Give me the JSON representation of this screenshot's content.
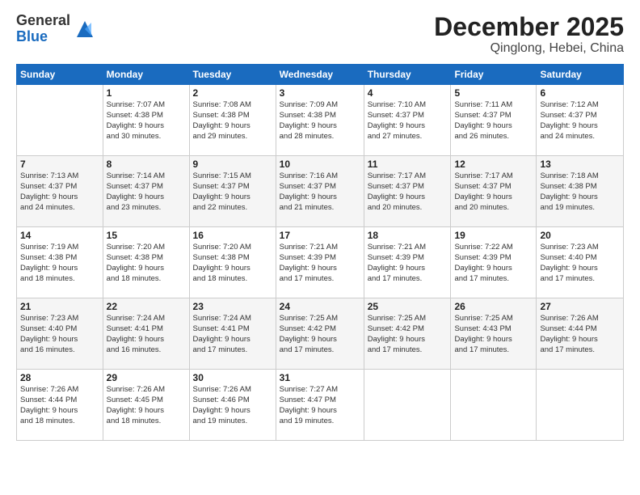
{
  "logo": {
    "general": "General",
    "blue": "Blue"
  },
  "title": "December 2025",
  "subtitle": "Qinglong, Hebei, China",
  "days_of_week": [
    "Sunday",
    "Monday",
    "Tuesday",
    "Wednesday",
    "Thursday",
    "Friday",
    "Saturday"
  ],
  "weeks": [
    [
      {
        "day": "",
        "info": ""
      },
      {
        "day": "1",
        "info": "Sunrise: 7:07 AM\nSunset: 4:38 PM\nDaylight: 9 hours\nand 30 minutes."
      },
      {
        "day": "2",
        "info": "Sunrise: 7:08 AM\nSunset: 4:38 PM\nDaylight: 9 hours\nand 29 minutes."
      },
      {
        "day": "3",
        "info": "Sunrise: 7:09 AM\nSunset: 4:38 PM\nDaylight: 9 hours\nand 28 minutes."
      },
      {
        "day": "4",
        "info": "Sunrise: 7:10 AM\nSunset: 4:37 PM\nDaylight: 9 hours\nand 27 minutes."
      },
      {
        "day": "5",
        "info": "Sunrise: 7:11 AM\nSunset: 4:37 PM\nDaylight: 9 hours\nand 26 minutes."
      },
      {
        "day": "6",
        "info": "Sunrise: 7:12 AM\nSunset: 4:37 PM\nDaylight: 9 hours\nand 24 minutes."
      }
    ],
    [
      {
        "day": "7",
        "info": "Sunrise: 7:13 AM\nSunset: 4:37 PM\nDaylight: 9 hours\nand 24 minutes."
      },
      {
        "day": "8",
        "info": "Sunrise: 7:14 AM\nSunset: 4:37 PM\nDaylight: 9 hours\nand 23 minutes."
      },
      {
        "day": "9",
        "info": "Sunrise: 7:15 AM\nSunset: 4:37 PM\nDaylight: 9 hours\nand 22 minutes."
      },
      {
        "day": "10",
        "info": "Sunrise: 7:16 AM\nSunset: 4:37 PM\nDaylight: 9 hours\nand 21 minutes."
      },
      {
        "day": "11",
        "info": "Sunrise: 7:17 AM\nSunset: 4:37 PM\nDaylight: 9 hours\nand 20 minutes."
      },
      {
        "day": "12",
        "info": "Sunrise: 7:17 AM\nSunset: 4:37 PM\nDaylight: 9 hours\nand 20 minutes."
      },
      {
        "day": "13",
        "info": "Sunrise: 7:18 AM\nSunset: 4:38 PM\nDaylight: 9 hours\nand 19 minutes."
      }
    ],
    [
      {
        "day": "14",
        "info": "Sunrise: 7:19 AM\nSunset: 4:38 PM\nDaylight: 9 hours\nand 18 minutes."
      },
      {
        "day": "15",
        "info": "Sunrise: 7:20 AM\nSunset: 4:38 PM\nDaylight: 9 hours\nand 18 minutes."
      },
      {
        "day": "16",
        "info": "Sunrise: 7:20 AM\nSunset: 4:38 PM\nDaylight: 9 hours\nand 18 minutes."
      },
      {
        "day": "17",
        "info": "Sunrise: 7:21 AM\nSunset: 4:39 PM\nDaylight: 9 hours\nand 17 minutes."
      },
      {
        "day": "18",
        "info": "Sunrise: 7:21 AM\nSunset: 4:39 PM\nDaylight: 9 hours\nand 17 minutes."
      },
      {
        "day": "19",
        "info": "Sunrise: 7:22 AM\nSunset: 4:39 PM\nDaylight: 9 hours\nand 17 minutes."
      },
      {
        "day": "20",
        "info": "Sunrise: 7:23 AM\nSunset: 4:40 PM\nDaylight: 9 hours\nand 17 minutes."
      }
    ],
    [
      {
        "day": "21",
        "info": "Sunrise: 7:23 AM\nSunset: 4:40 PM\nDaylight: 9 hours\nand 16 minutes."
      },
      {
        "day": "22",
        "info": "Sunrise: 7:24 AM\nSunset: 4:41 PM\nDaylight: 9 hours\nand 16 minutes."
      },
      {
        "day": "23",
        "info": "Sunrise: 7:24 AM\nSunset: 4:41 PM\nDaylight: 9 hours\nand 17 minutes."
      },
      {
        "day": "24",
        "info": "Sunrise: 7:25 AM\nSunset: 4:42 PM\nDaylight: 9 hours\nand 17 minutes."
      },
      {
        "day": "25",
        "info": "Sunrise: 7:25 AM\nSunset: 4:42 PM\nDaylight: 9 hours\nand 17 minutes."
      },
      {
        "day": "26",
        "info": "Sunrise: 7:25 AM\nSunset: 4:43 PM\nDaylight: 9 hours\nand 17 minutes."
      },
      {
        "day": "27",
        "info": "Sunrise: 7:26 AM\nSunset: 4:44 PM\nDaylight: 9 hours\nand 17 minutes."
      }
    ],
    [
      {
        "day": "28",
        "info": "Sunrise: 7:26 AM\nSunset: 4:44 PM\nDaylight: 9 hours\nand 18 minutes."
      },
      {
        "day": "29",
        "info": "Sunrise: 7:26 AM\nSunset: 4:45 PM\nDaylight: 9 hours\nand 18 minutes."
      },
      {
        "day": "30",
        "info": "Sunrise: 7:26 AM\nSunset: 4:46 PM\nDaylight: 9 hours\nand 19 minutes."
      },
      {
        "day": "31",
        "info": "Sunrise: 7:27 AM\nSunset: 4:47 PM\nDaylight: 9 hours\nand 19 minutes."
      },
      {
        "day": "",
        "info": ""
      },
      {
        "day": "",
        "info": ""
      },
      {
        "day": "",
        "info": ""
      }
    ]
  ]
}
